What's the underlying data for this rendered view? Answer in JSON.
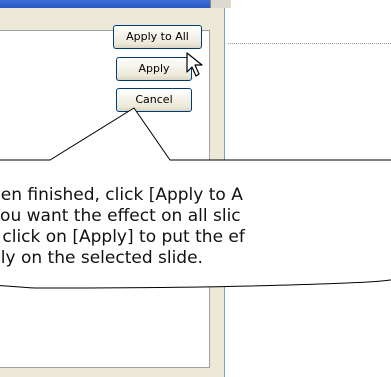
{
  "dialog": {
    "buttons": {
      "apply_to_all": "Apply to All",
      "apply": "Apply",
      "cancel": "Cancel"
    }
  },
  "callout": {
    "lines": [
      "hen finished, click [Apply to A",
      "you want the effect on all slic",
      "r click on [Apply] to put the ef",
      "nly on the selected slide."
    ]
  }
}
